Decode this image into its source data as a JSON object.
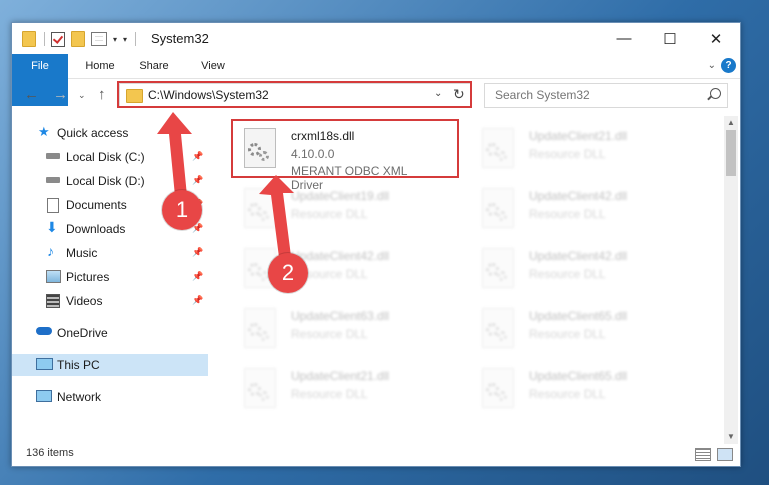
{
  "window": {
    "title": "System32"
  },
  "ribbon": {
    "tabs": [
      "File",
      "Home",
      "Share",
      "View"
    ]
  },
  "address": {
    "path": "C:\\Windows\\System32"
  },
  "search": {
    "placeholder": "Search System32"
  },
  "nav": {
    "items": [
      {
        "label": "Quick access",
        "icon": "star-icon",
        "pinned": false
      },
      {
        "label": "Local Disk (C:)",
        "icon": "drive-icon",
        "pinned": true
      },
      {
        "label": "Local Disk (D:)",
        "icon": "drive-icon",
        "pinned": true
      },
      {
        "label": "Documents",
        "icon": "document-icon",
        "pinned": true
      },
      {
        "label": "Downloads",
        "icon": "download-icon",
        "pinned": true
      },
      {
        "label": "Music",
        "icon": "music-icon",
        "pinned": true
      },
      {
        "label": "Pictures",
        "icon": "pictures-icon",
        "pinned": true
      },
      {
        "label": "Videos",
        "icon": "video-icon",
        "pinned": true
      },
      {
        "label": "OneDrive",
        "icon": "cloud-icon",
        "pinned": false
      },
      {
        "label": "This PC",
        "icon": "computer-icon",
        "pinned": false,
        "selected": true
      },
      {
        "label": "Network",
        "icon": "network-icon",
        "pinned": false
      }
    ]
  },
  "files": [
    {
      "name": "crxml18s.dll",
      "line2": "4.10.0.0",
      "line3": "MERANT ODBC XML Driver",
      "blurred": false
    },
    {
      "name": "UpdateClient21.dll",
      "line2": "Resource DLL",
      "blurred": true
    },
    {
      "name": "UpdateClient19.dll",
      "line2": "Resource DLL",
      "blurred": true
    },
    {
      "name": "UpdateClient42.dll",
      "line2": "Resource DLL",
      "blurred": true
    },
    {
      "name": "UpdateClient42.dll",
      "line2": "Resource DLL",
      "blurred": true
    },
    {
      "name": "UpdateClient42.dll",
      "line2": "Resource DLL",
      "blurred": true
    },
    {
      "name": "UpdateClient63.dll",
      "line2": "Resource DLL",
      "blurred": true
    },
    {
      "name": "UpdateClient65.dll",
      "line2": "Resource DLL",
      "blurred": true
    },
    {
      "name": "UpdateClient21.dll",
      "line2": "Resource DLL",
      "blurred": true
    },
    {
      "name": "UpdateClient65.dll",
      "line2": "Resource DLL",
      "blurred": true
    }
  ],
  "status": {
    "item_count": "136 items"
  },
  "annotations": {
    "step1": "1",
    "step2": "2",
    "highlight_color": "#d53b3b",
    "circle_color": "#e84646"
  },
  "colors": {
    "accent": "#1979ca",
    "selection": "#cce4f7"
  }
}
